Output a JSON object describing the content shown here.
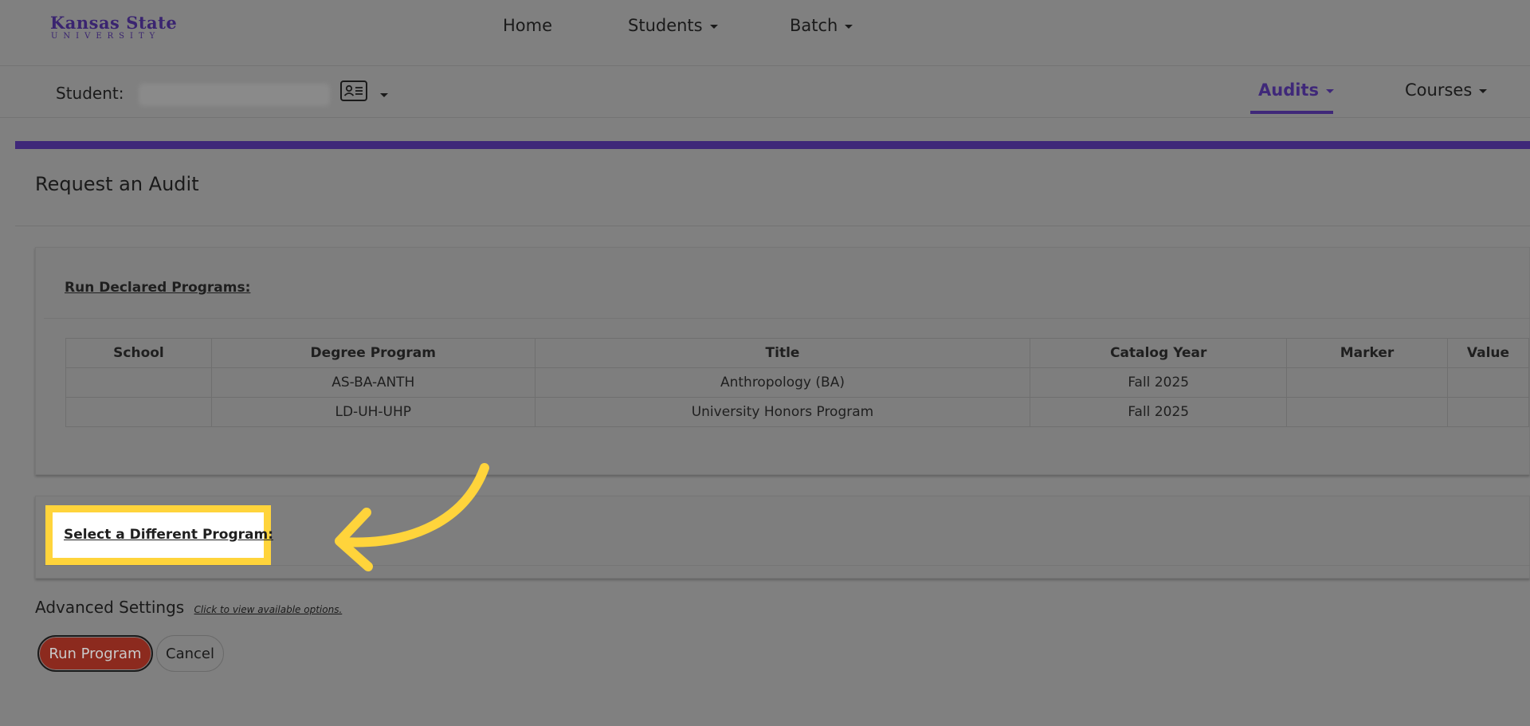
{
  "logo": {
    "line1": "Kansas State",
    "line2": "UNIVERSITY"
  },
  "top_nav": [
    {
      "label": "Home",
      "has_dropdown": false
    },
    {
      "label": "Students",
      "has_dropdown": true
    },
    {
      "label": "Batch",
      "has_dropdown": true
    }
  ],
  "student_bar": {
    "label": "Student:",
    "tabs": [
      {
        "label": "Audits",
        "active": true
      },
      {
        "label": "Courses",
        "active": false
      }
    ]
  },
  "page": {
    "title": "Request an Audit"
  },
  "declared": {
    "heading": "Run Declared Programs:",
    "columns": [
      "School",
      "Degree Program",
      "Title",
      "Catalog Year",
      "Marker",
      "Value"
    ],
    "rows": [
      [
        "",
        "AS-BA-ANTH",
        "Anthropology (BA)",
        "Fall 2025",
        "",
        ""
      ],
      [
        "",
        "LD-UH-UHP",
        "University Honors Program",
        "Fall 2025",
        "",
        ""
      ]
    ]
  },
  "different": {
    "heading": "Select a Different Program:"
  },
  "advanced": {
    "label": "Advanced Settings",
    "hint": "Click to view available options."
  },
  "buttons": {
    "run": "Run Program",
    "cancel": "Cancel"
  },
  "colors": {
    "brand_purple": "#3f2879",
    "highlight_yellow": "#ffd43b",
    "run_button": "#8c2a1e"
  },
  "icons": [
    "id-card-icon",
    "caret-down-icon",
    "curved-arrow-icon"
  ]
}
